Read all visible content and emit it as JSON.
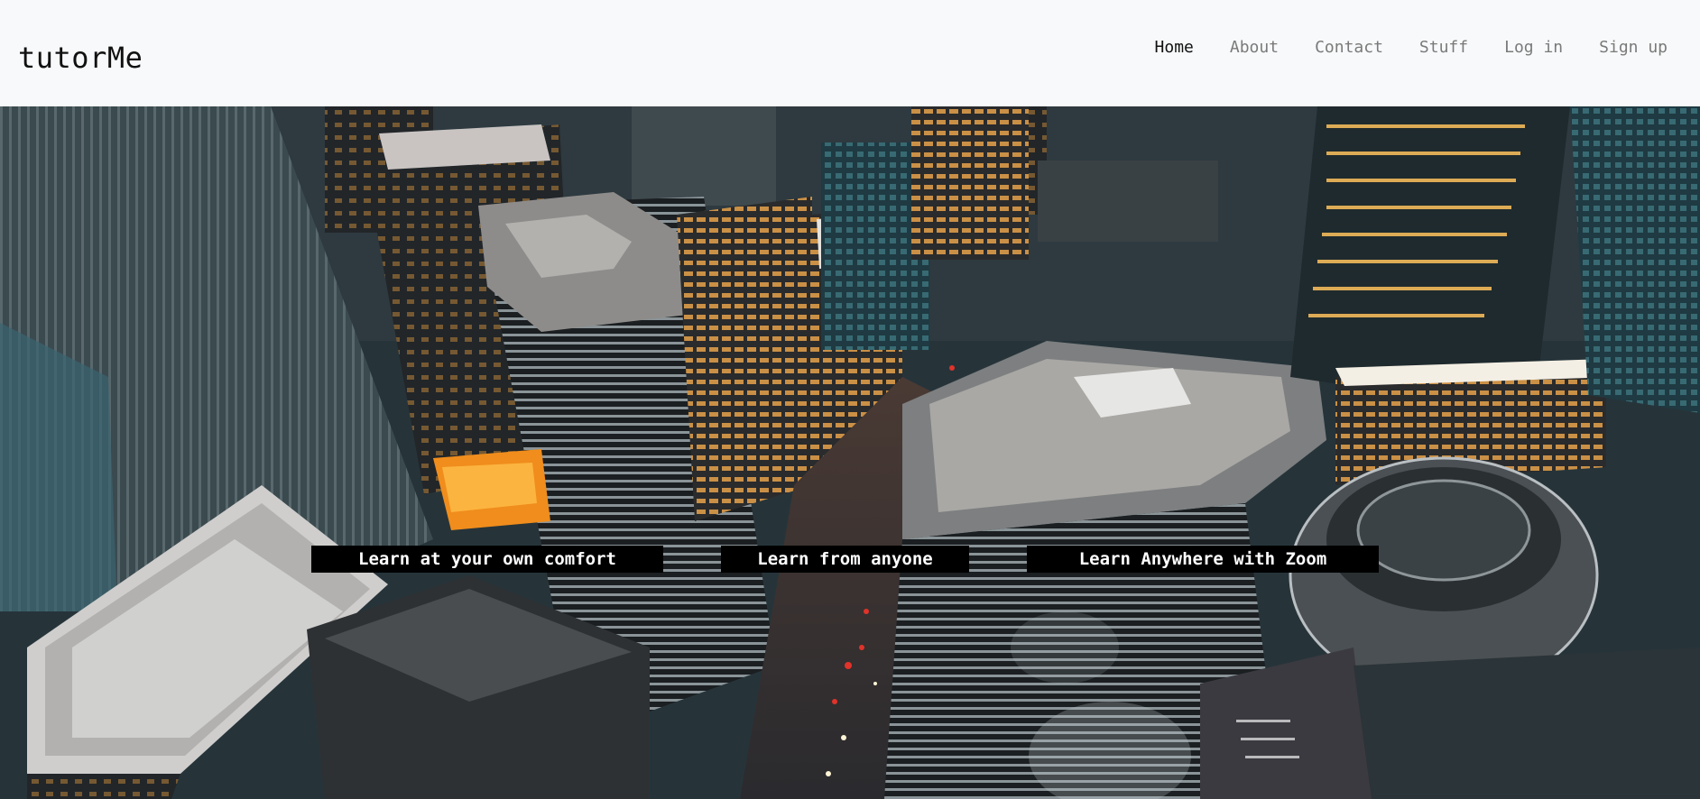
{
  "navbar": {
    "brand": "tutorMe",
    "links": [
      {
        "label": "Home",
        "active": true
      },
      {
        "label": "About",
        "active": false
      },
      {
        "label": "Contact",
        "active": false
      },
      {
        "label": "Stuff",
        "active": false
      },
      {
        "label": "Log in",
        "active": false
      },
      {
        "label": "Sign up",
        "active": false
      }
    ]
  },
  "hero": {
    "image": "aerial-city-skyline-night",
    "taglines": [
      "Learn at your own comfort",
      "Learn from anyone",
      "Learn Anywhere with Zoom"
    ]
  },
  "colors": {
    "navbar_bg": "#f8f9fa",
    "active_link": "#111111",
    "inactive_link": "#7a7a7a",
    "tagline_bg": "#000000",
    "tagline_text": "#ffffff"
  }
}
